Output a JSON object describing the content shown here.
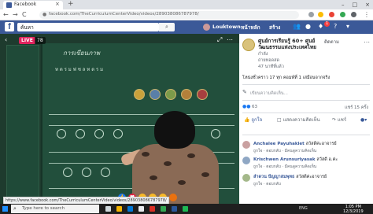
{
  "browser": {
    "tab_title": "Facebook",
    "tab_close": "×",
    "new_tab": "+",
    "controls": [
      "–",
      "□",
      "×"
    ],
    "nav": {
      "back": "←",
      "forward": "→",
      "reload": "C"
    },
    "url": "facebook.com/TheCurriculumCenterVideo/videos/289038086787978/",
    "status_url": "https://www.facebook.com/TheCurriculumCenterVideo/videos/289038086787978/"
  },
  "fb_header": {
    "logo": "f",
    "search_value": "ค้นหา",
    "user_name": "Louktown",
    "home_label": "หน้าหลัก",
    "create_label": "สร้าง",
    "notification_badge": "1"
  },
  "video": {
    "live_label": "LIVE",
    "viewer_count": "78",
    "board_title": "การเขียนภาพ",
    "board_subtitle": "ท ด ร ม ฟ ซ ล ท ด ร ม"
  },
  "panel": {
    "page_name": "ศูนย์การเรียนรู้ 60+ ศูนย์วัฒนธรรมแห่งประเทศไทย",
    "page_following": "กำลัง",
    "following_button": "ติดตาม",
    "time_text": "ถ่ายทอดสด",
    "views_text": "47 นาทีที่แล้ว",
    "post_desc": "โหน่งชั่วคราว 17 ทุก คอมพ์ที่ 1 เสมือนจากจริง",
    "write_caption": "เขียนความคิดเห็น...",
    "reaction_count": "63",
    "share_count": "แชร์ 15 ครั้ง",
    "actions": [
      {
        "label": "ถูกใจ"
      },
      {
        "label": "แสดงความคิดเห็น"
      },
      {
        "label": "แชร์"
      }
    ],
    "comments": [
      {
        "name": "Anchalee Payuhakiet",
        "text": "สวัสดีค่ะอาจารย์",
        "meta": "ถูกใจ · ตอบกลับ · มีคนดูความคิดเห็น"
      },
      {
        "name": "Krischwen Arunsuriyasak",
        "text": "สวัสดี อ.ค่ะ",
        "meta": "ถูกใจ · ตอบกลับ · มีคนดูความคิดเห็น"
      },
      {
        "name": "ลำดวน ปัญญาสมพุทธ",
        "text": "สวัสดีค่ะอาจารย์",
        "meta": "ถูกใจ · ตอบกลับ"
      }
    ]
  },
  "taskbar": {
    "search_placeholder": "Type here to search",
    "tray": "ENG",
    "time": "1:05 PM",
    "date": "12/3/2019"
  },
  "colors": {
    "facebook_blue": "#3b5998",
    "chalkboard": "#224f3c",
    "live_red": "#e0245e"
  },
  "icons": {
    "reactions": [
      "like",
      "love",
      "haha",
      "wow",
      "sad",
      "angry"
    ]
  }
}
